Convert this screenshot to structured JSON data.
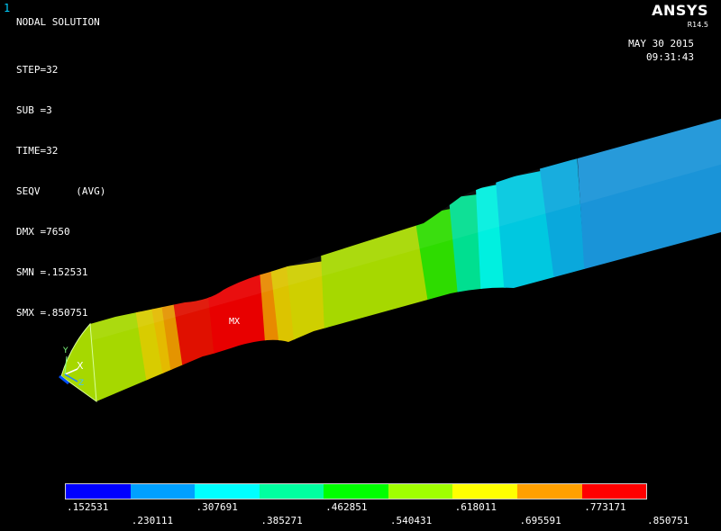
{
  "window_number": "1",
  "title": "NODAL SOLUTION",
  "info": [
    "STEP=32",
    "SUB =3",
    "TIME=32",
    "SEQV      (AVG)",
    "DMX =7650",
    "SMN =.152531",
    "SMX =.850751"
  ],
  "brand": "ANSYS",
  "version": "R14.5",
  "date": "MAY 30 2015",
  "time": "09:31:43",
  "max_label": "MX",
  "triad": {
    "x": "X",
    "y": "Y",
    "z": "Z"
  },
  "legend": {
    "colors": [
      "#0000ff",
      "#00a0ff",
      "#00ffff",
      "#00ffa0",
      "#00ff00",
      "#a0ff00",
      "#ffff00",
      "#ffa000",
      "#ff0000"
    ],
    "ticks_top": [
      ".152531",
      ".307691",
      ".462851",
      ".618011",
      ".773171"
    ],
    "ticks_bottom": [
      ".230111",
      ".385271",
      ".540431",
      ".695591",
      ".850751"
    ]
  }
}
